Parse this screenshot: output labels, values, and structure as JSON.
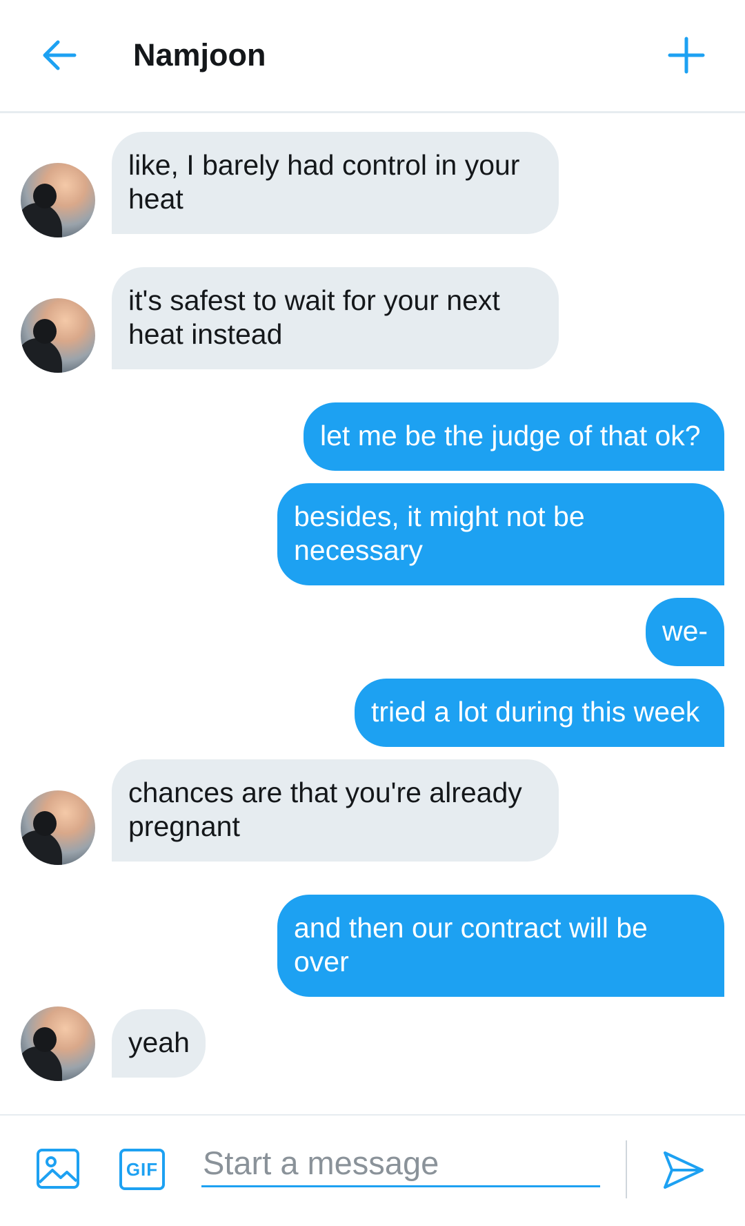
{
  "header": {
    "title": "Namjoon",
    "back_icon": "arrow-left-icon",
    "new_icon": "plus-icon",
    "accent": "#1da1f2"
  },
  "messages": [
    {
      "side": "in",
      "text": "like, I barely had control in your heat"
    },
    {
      "side": "in",
      "text": "it's safest to wait for your next heat instead"
    },
    {
      "side": "out",
      "text": "let me be the judge of that ok?"
    },
    {
      "side": "out",
      "text": "besides, it might not be necessary"
    },
    {
      "side": "out",
      "text": "we-"
    },
    {
      "side": "out",
      "text": "tried a lot during this week"
    },
    {
      "side": "in",
      "text": "chances are that you're already pregnant"
    },
    {
      "side": "out",
      "text": "and then our contract will be over"
    },
    {
      "side": "in",
      "text": "yeah"
    }
  ],
  "colors": {
    "incoming_bubble": "#e6ecf0",
    "outgoing_bubble": "#1da1f2",
    "incoming_text": "#14171a",
    "outgoing_text": "#ffffff"
  },
  "composer": {
    "gif_label": "GIF",
    "placeholder": "Start a message",
    "value": "",
    "image_icon": "image-icon",
    "send_icon": "send-icon"
  }
}
